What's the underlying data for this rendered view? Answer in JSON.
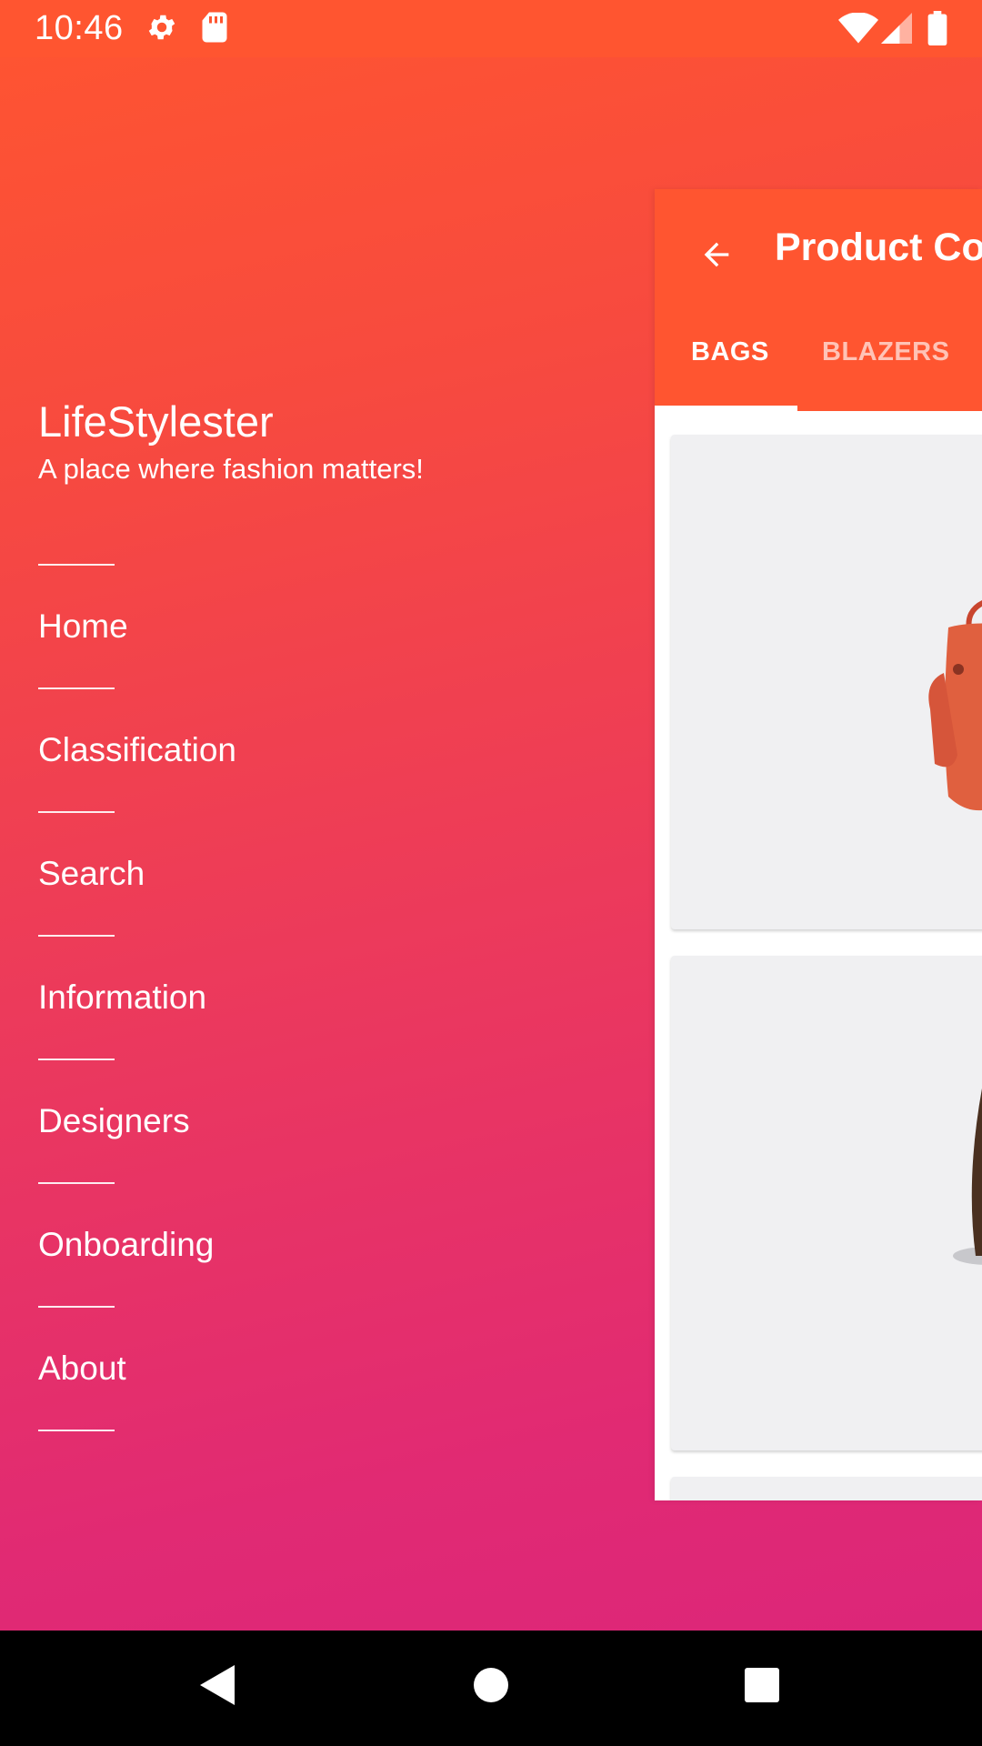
{
  "status_bar": {
    "time": "10:46",
    "icons": [
      "gear-icon",
      "sd-card-icon",
      "wifi-icon",
      "cell-signal-icon",
      "battery-icon"
    ]
  },
  "drawer": {
    "app_name": "LifeStylester",
    "tagline": "A place where fashion matters!",
    "menu_items": [
      {
        "label": "Home"
      },
      {
        "label": "Classification"
      },
      {
        "label": "Search"
      },
      {
        "label": "Information"
      },
      {
        "label": "Designers"
      },
      {
        "label": "Onboarding"
      },
      {
        "label": "About"
      }
    ]
  },
  "content": {
    "title": "Product Col",
    "tabs": [
      {
        "label": "BAGS",
        "selected": true
      },
      {
        "label": "BLAZERS",
        "selected": false
      }
    ],
    "cards": [
      "orange-bag-image",
      "brown-monogram-bag-image"
    ]
  },
  "nav_bar": {
    "icons": [
      "back-icon",
      "home-icon",
      "recents-icon"
    ]
  },
  "colors": {
    "accent": "#ff5530",
    "gradient_top": "#ff5530",
    "gradient_bottom": "#dc2679"
  }
}
